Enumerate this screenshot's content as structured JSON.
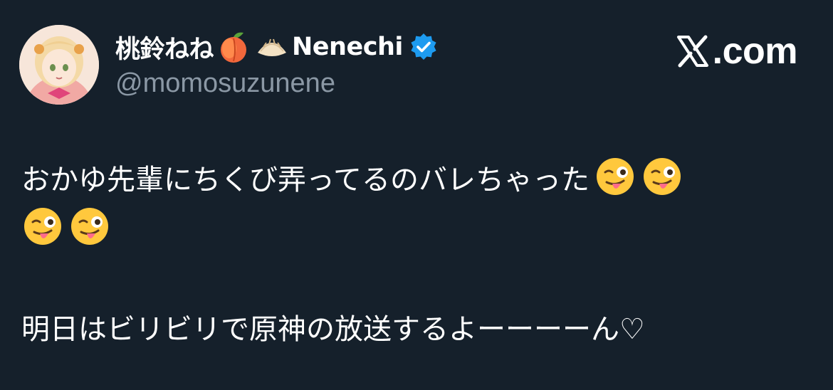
{
  "post": {
    "author": {
      "display_name": "桃鈴ねね",
      "nickname": "Nenechi",
      "handle": "@momosuzunene",
      "verified": true,
      "verified_color": "#1d9bf0",
      "name_icons": [
        "peach-icon",
        "dumpling-icon"
      ]
    },
    "brand": {
      "text": ".com",
      "logo": "x-logo-icon"
    },
    "text": {
      "line1": "おかゆ先輩にちくび弄ってるのバレちゃった",
      "line1_emoji": [
        "winking-face-with-tongue-icon",
        "winking-face-with-tongue-icon",
        "winking-face-with-tongue-icon",
        "winking-face-with-tongue-icon"
      ],
      "line2": "明日はビリビリで原神の放送するよーーーーん♡"
    }
  },
  "colors": {
    "background": "#15202b",
    "primary_text": "#ffffff",
    "secondary_text": "#8b98a5"
  }
}
